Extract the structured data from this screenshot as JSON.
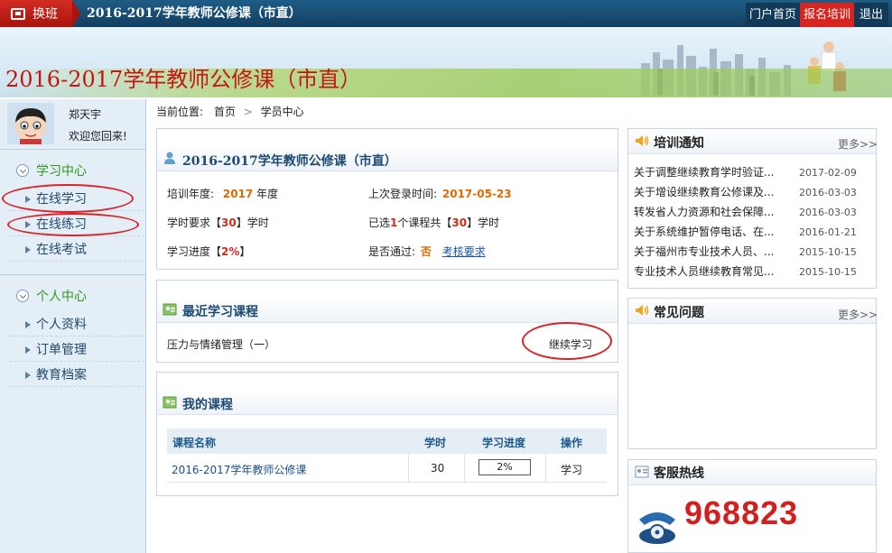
{
  "topbar": {
    "switch_label": "换班",
    "title": "2016-2017学年教师公修课（市直）",
    "nav": [
      "门户首页",
      "报名培训",
      "退出"
    ]
  },
  "banner": {
    "title": "2016-2017学年教师公修课（市直）"
  },
  "user": {
    "name": "郑天宇",
    "welcome": "欢迎您回来!"
  },
  "sidebar": {
    "study_center": "学习中心",
    "study_items": [
      "在线学习",
      "在线练习",
      "在线考试"
    ],
    "personal_center": "个人中心",
    "personal_items": [
      "个人资料",
      "订单管理",
      "教育档案"
    ]
  },
  "breadcrumb": {
    "label": "当前位置:",
    "home": "首页",
    "sep": ">",
    "current": "学员中心"
  },
  "course_info": {
    "title": "2016-2017学年教师公修课（市直）",
    "year_label": "培训年度:",
    "year_value": "2017",
    "year_unit": "年度",
    "last_login_label": "上次登录时间:",
    "last_login_value": "2017-05-23",
    "hours_req_pre": "学时要求【",
    "hours_req_value": "30",
    "hours_req_post": "】学时",
    "selected_pre": "已选",
    "selected_count": "1",
    "selected_mid": "个课程共【",
    "selected_hours": "30",
    "selected_post": "】学时",
    "progress_pre": "学习进度【",
    "progress_value": "2%",
    "progress_post": "】",
    "passed_label": "是否通过:",
    "passed_value": "否",
    "assess_link": "考核要求"
  },
  "recent": {
    "title": "最近学习课程",
    "course": "压力与情绪管理（一）",
    "continue_label": "继续学习"
  },
  "mycourses": {
    "title": "我的课程",
    "headers": [
      "课程名称",
      "学时",
      "学习进度",
      "操作"
    ],
    "rows": [
      {
        "name": "2016-2017学年教师公修课",
        "hours": "30",
        "progress": "2%",
        "action": "学习"
      }
    ]
  },
  "notice": {
    "title": "培训通知",
    "more": "更多>>",
    "items": [
      {
        "text": "关于调整继续教育学时验证...",
        "date": "2017-02-09"
      },
      {
        "text": "关于增设继续教育公修课及...",
        "date": "2016-03-03"
      },
      {
        "text": "转发省人力资源和社会保障...",
        "date": "2016-03-03"
      },
      {
        "text": "关于系统维护暂停电话、在...",
        "date": "2016-01-21"
      },
      {
        "text": "关于福州市专业技术人员、...",
        "date": "2015-10-15"
      },
      {
        "text": "专业技术人员继续教育常见...",
        "date": "2015-10-15"
      }
    ]
  },
  "faq": {
    "title": "常见问题",
    "more": "更多>>"
  },
  "hotline": {
    "title": "客服热线",
    "number": "968823"
  },
  "colors": {
    "brand_red": "#c41616",
    "nav_blue": "#1f5d86",
    "accent_green": "#2f9a1c",
    "highlight_orange": "#e06a00"
  }
}
